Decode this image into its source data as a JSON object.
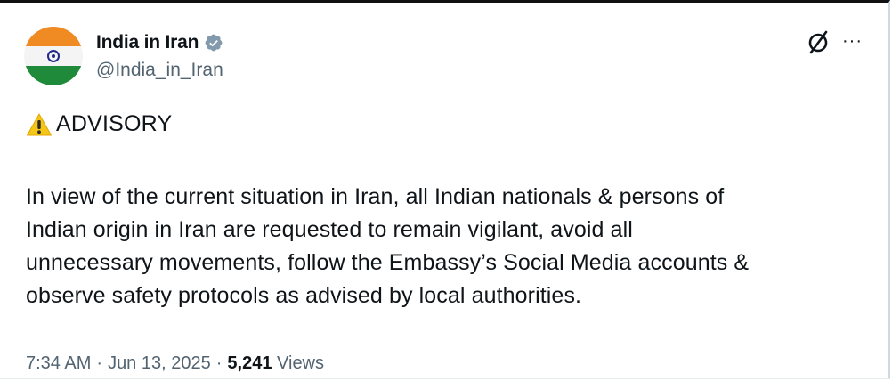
{
  "account": {
    "display_name": "India in Iran",
    "handle": "@India_in_Iran",
    "verified": true,
    "verified_color": "#829aab",
    "avatar_colors": [
      "#f08b24",
      "#f4f4f4",
      "#1f8a3a"
    ],
    "avatar_icon": "india-flag-avatar"
  },
  "actions": {
    "grok_icon": "grok-icon",
    "more_label": "···"
  },
  "post": {
    "advisory_icon": "warning-icon",
    "advisory_title": "ADVISORY",
    "body": "In view of the current situation in Iran, all Indian nationals & persons of\nIndian origin in Iran are requested to remain vigilant, avoid all\nunnecessary movements, follow the Embassy’s Social Media accounts &\nobserve safety protocols as advised by local authorities."
  },
  "meta": {
    "time": "7:34 AM",
    "separator": "·",
    "date": "Jun 13, 2025",
    "views_count": "5,241",
    "views_label": "Views"
  }
}
